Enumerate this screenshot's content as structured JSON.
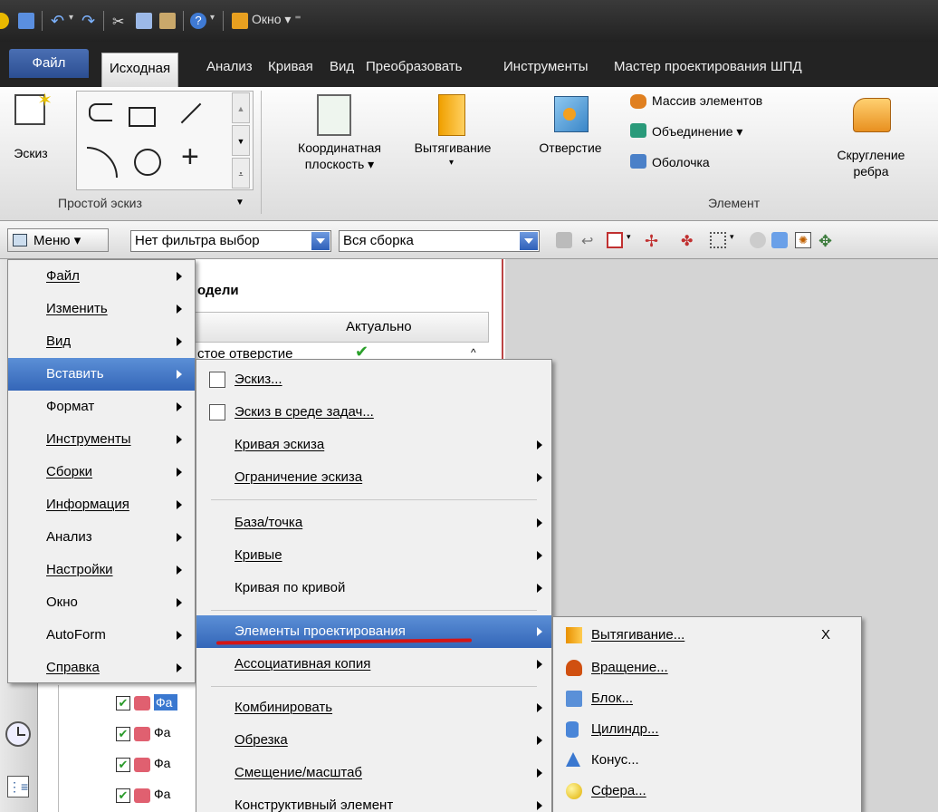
{
  "qat": {
    "window_label": "Окно ▾ ⁼"
  },
  "tabs": [
    "Файл",
    "Исходная",
    "Анализ",
    "Кривая",
    "Вид",
    "Преобразовать",
    "Инструменты",
    "Мастер проектирования ШПД"
  ],
  "ribbon": {
    "sketch_label": "Эскиз",
    "simple_sketch_group": "Простой эскиз",
    "datum_plane": [
      "Координатная",
      "плоскость ▾"
    ],
    "extrude": "Вытягивание",
    "hole": "Отверстие",
    "pattern": "Массив элементов",
    "unite": "Объединение ▾",
    "shell": "Оболочка",
    "edge_blend": [
      "Скругление",
      "ребра"
    ],
    "feature_group": "Элемент"
  },
  "selbar": {
    "menu_label": "Меню ▾",
    "filter_value": "Нет фильтра выбор",
    "scope_value": "Вся сборка"
  },
  "navigator": {
    "title": "одели",
    "col_current": "Актуально",
    "row_partial": "стое отверстие",
    "rows": [
      "Фа",
      "Фа",
      "Фа",
      "Фа"
    ]
  },
  "main_menu": {
    "items": [
      "Файл",
      "Изменить",
      "Вид",
      "Вставить",
      "Формат",
      "Инструменты",
      "Сборки",
      "Информация",
      "Анализ",
      "Настройки",
      "Окно",
      "AutoForm",
      "Справка"
    ]
  },
  "insert_menu": {
    "items": [
      "Эскиз...",
      "Эскиз в среде задач...",
      "Кривая эскиза",
      "Ограничение эскиза",
      "База/точка",
      "Кривые",
      "Кривая по кривой",
      "Элементы проектирования",
      "Ассоциативная копия",
      "Комбинировать",
      "Обрезка",
      "Смещение/масштаб",
      "Конструктивный элемент"
    ]
  },
  "design_menu": {
    "items": [
      "Вытягивание...",
      "Вращение...",
      "Блок...",
      "Цилиндр...",
      "Конус...",
      "Сфера..."
    ],
    "shortcut": "X"
  },
  "colors": {
    "highlight": "#3f74c4",
    "underline_mark": "#d41515",
    "frame": "#232323"
  }
}
